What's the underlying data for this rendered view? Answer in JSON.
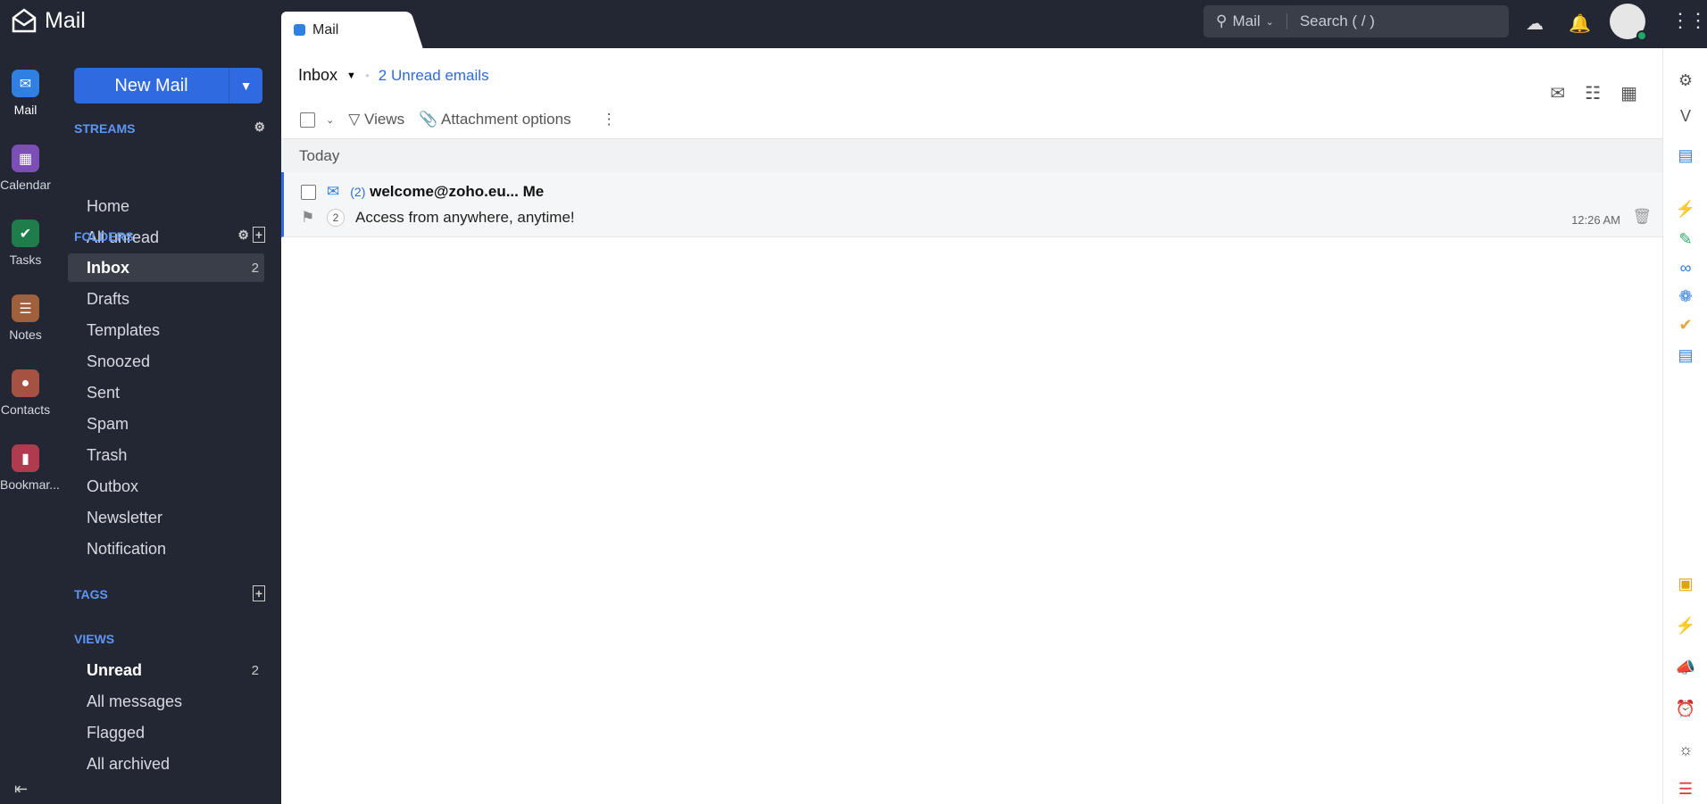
{
  "app": {
    "title": "Mail",
    "tab": "Mail"
  },
  "search": {
    "scope": "Mail",
    "placeholder": "Search ( / )"
  },
  "apps": [
    {
      "label": "Mail",
      "color": "#2f80e0",
      "icon": "mail-icon"
    },
    {
      "label": "Calendar",
      "color": "#7b4fb5",
      "icon": "calendar-icon"
    },
    {
      "label": "Tasks",
      "color": "#1e7d4a",
      "icon": "check-icon"
    },
    {
      "label": "Notes",
      "color": "#a0603c",
      "icon": "notes-icon"
    },
    {
      "label": "Contacts",
      "color": "#a55242",
      "icon": "contact-icon"
    },
    {
      "label": "Bookmar...",
      "color": "#b03a4e",
      "icon": "bookmark-icon"
    }
  ],
  "sidebar": {
    "new_mail": "New Mail",
    "streams": {
      "title": "STREAMS",
      "items": [
        "Home",
        "All unread"
      ]
    },
    "folders": {
      "title": "FOLDERS",
      "items": [
        {
          "label": "Inbox",
          "count": "2"
        },
        {
          "label": "Drafts"
        },
        {
          "label": "Templates"
        },
        {
          "label": "Snoozed"
        },
        {
          "label": "Sent"
        },
        {
          "label": "Spam"
        },
        {
          "label": "Trash"
        },
        {
          "label": "Outbox"
        },
        {
          "label": "Newsletter"
        },
        {
          "label": "Notification"
        }
      ]
    },
    "tags": {
      "title": "TAGS"
    },
    "views": {
      "title": "VIEWS",
      "items": [
        {
          "label": "Unread",
          "count": "2"
        },
        {
          "label": "All messages"
        },
        {
          "label": "Flagged"
        },
        {
          "label": "All archived"
        }
      ]
    }
  },
  "main": {
    "folder": "Inbox",
    "unread": "2 Unread emails",
    "toolbar": {
      "views": "Views",
      "attachment": "Attachment options"
    },
    "group": "Today",
    "emails": [
      {
        "thread_count": "(2)",
        "from": "welcome@zoho.eu... Me",
        "count_badge": "2",
        "subject": "Access from anywhere, anytime!",
        "time": "12:26 AM"
      }
    ]
  }
}
